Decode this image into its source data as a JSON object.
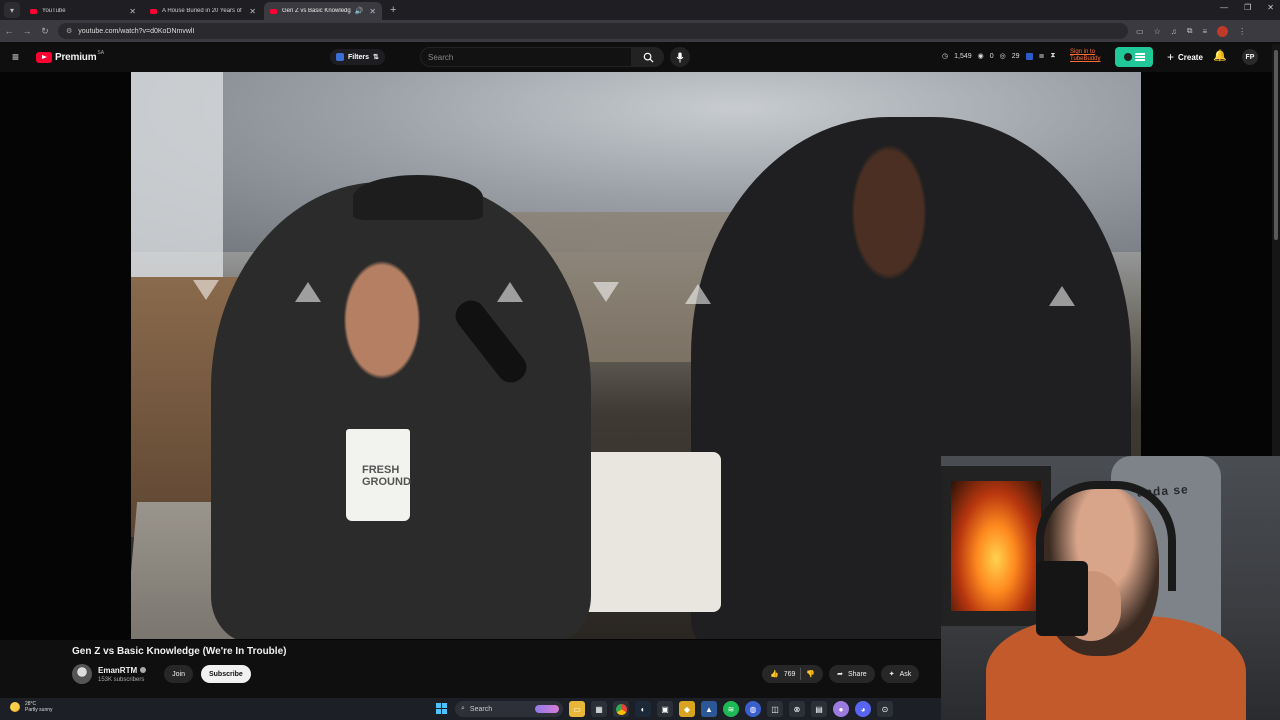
{
  "browser": {
    "tabs": [
      {
        "title": "YouTube",
        "active": false,
        "audio": false
      },
      {
        "title": "A House Buried in 20 Years of",
        "active": false,
        "audio": false
      },
      {
        "title": "Gen Z vs Basic Knowledge",
        "active": true,
        "audio": true
      }
    ],
    "url": "youtube.com/watch?v=d0KoDNmvwlI",
    "accent_color": "#ff0033"
  },
  "masthead": {
    "brand": "Premium",
    "region": "SA",
    "filters_label": "Filters",
    "search_placeholder": "Search",
    "stats": {
      "views": "1,549",
      "zero": "0",
      "count": "29"
    },
    "tubebuddy_line1": "Sign in to",
    "tubebuddy_line2": "TubeBuddy",
    "create_label": "Create",
    "avatar_initials": "FP"
  },
  "video": {
    "title": "Gen Z vs Basic Knowledge (We're In Trouble)",
    "cup_text": "FRESH GROUND"
  },
  "channel": {
    "name": "EmanRTM",
    "subscribers": "153K subscribers",
    "join_label": "Join",
    "subscribe_label": "Subscribe"
  },
  "actions": {
    "like_count": "769",
    "share_label": "Share",
    "ask_label": "Ask"
  },
  "webcam": {
    "chair_text": "anda se"
  },
  "taskbar": {
    "temperature": "28°C",
    "weather": "Partly sunny",
    "search_label": "Search"
  }
}
